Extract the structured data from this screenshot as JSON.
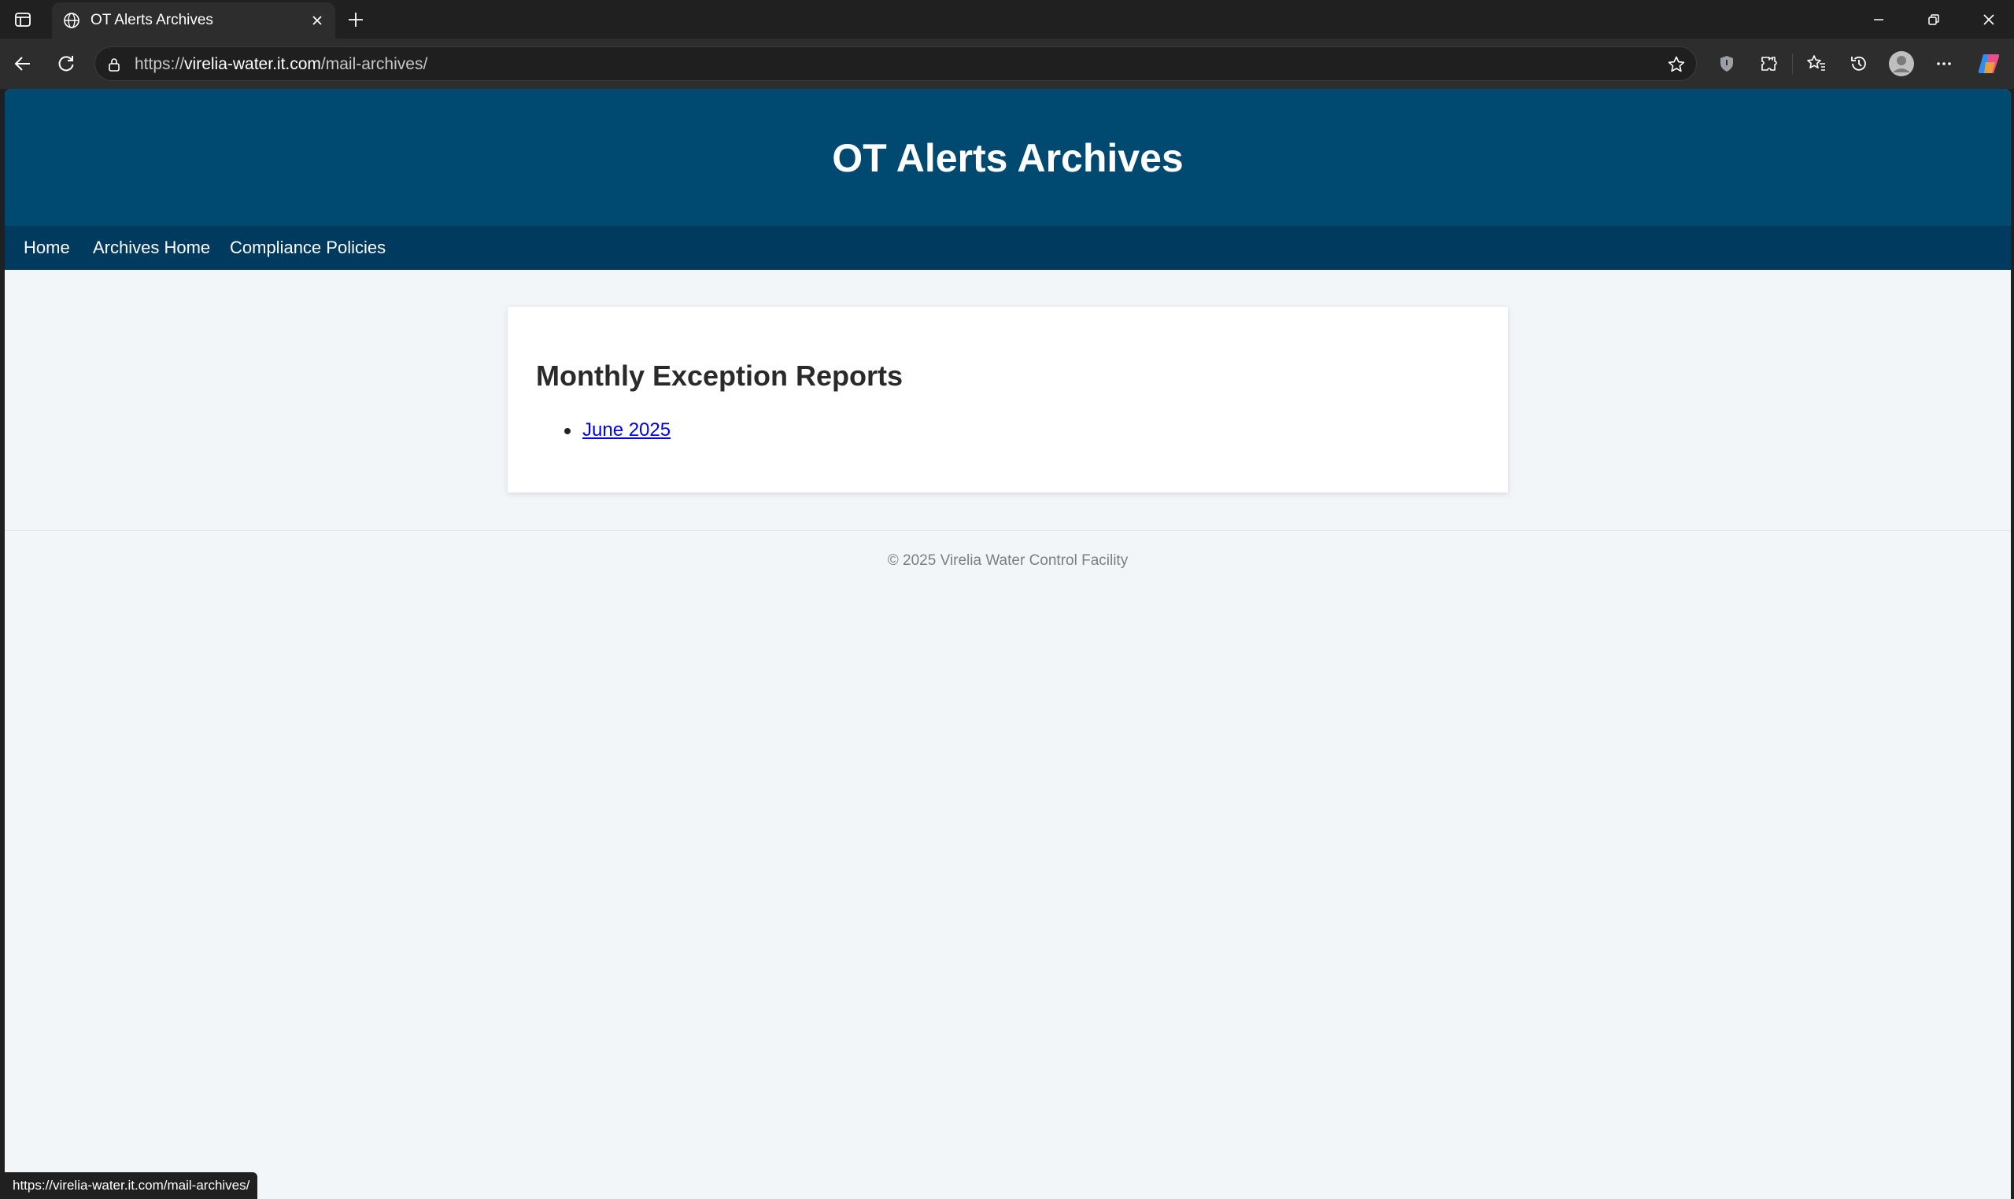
{
  "browser": {
    "tab_title": "OT Alerts Archives",
    "url_scheme": "https://",
    "url_host": "virelia-water.it.com",
    "url_path": "/mail-archives/",
    "status_url": "https://virelia-water.it.com/mail-archives/",
    "icons": [
      "sidebar-toggle-icon",
      "globe-icon",
      "close-icon",
      "plus-icon",
      "minimize-icon",
      "restore-icon",
      "window-close-icon",
      "back-icon",
      "reload-icon",
      "lock-icon",
      "star-icon",
      "shield-icon",
      "extensions-icon",
      "favorites-icon",
      "history-icon",
      "profile-icon",
      "more-icon",
      "copilot-icon"
    ]
  },
  "page": {
    "header_title": "OT Alerts Archives",
    "nav": {
      "home": "Home",
      "archives_home": "Archives Home",
      "compliance": "Compliance Policies"
    },
    "card": {
      "heading": "Monthly Exception Reports",
      "links": [
        "June 2025"
      ]
    },
    "footer": "© 2025 Virelia Water Control Facility"
  },
  "colors": {
    "header_bg": "#004a72",
    "nav_bg": "#003a5e",
    "page_bg": "#f3f6f9",
    "link": "#0000ee"
  }
}
